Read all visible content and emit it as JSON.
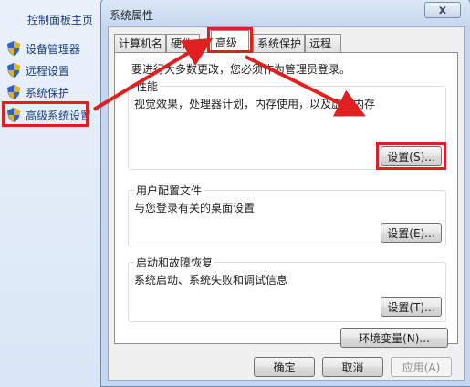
{
  "control_panel": {
    "home_label": "控制面板主页",
    "nav_items": [
      {
        "label": "设备管理器",
        "icon": "shield-icon"
      },
      {
        "label": "远程设置",
        "icon": "shield-icon"
      },
      {
        "label": "系统保护",
        "icon": "shield-icon"
      },
      {
        "label": "高级系统设置",
        "icon": "shield-icon"
      }
    ]
  },
  "dialog": {
    "title": "系统属性",
    "close_label": "x",
    "tabs": [
      {
        "label": "计算机名"
      },
      {
        "label": "硬件"
      },
      {
        "label": "高级"
      },
      {
        "label": "系统保护"
      },
      {
        "label": "远程"
      }
    ],
    "active_tab": "高级",
    "intro_text": "要进行大多数更改，您必须作为管理员登录。",
    "performance": {
      "title": "性能",
      "description": "视觉效果，处理器计划，内存使用，以及虚拟内存",
      "button_label": "设置(S)..."
    },
    "user_profiles": {
      "title": "用户配置文件",
      "description": "与您登录有关的桌面设置",
      "button_label": "设置(E)..."
    },
    "startup_recovery": {
      "title": "启动和故障恢复",
      "description": "系统启动、系统失败和调试信息",
      "button_label": "设置(T)..."
    },
    "env_vars_label": "环境变量(N)...",
    "ok_label": "确定",
    "cancel_label": "取消",
    "apply_label": "应用(A)"
  },
  "colors": {
    "highlight": "#e02020",
    "link": "#1d3e7c",
    "shield_blue": "#2f62c9",
    "shield_gold": "#e2b324"
  }
}
